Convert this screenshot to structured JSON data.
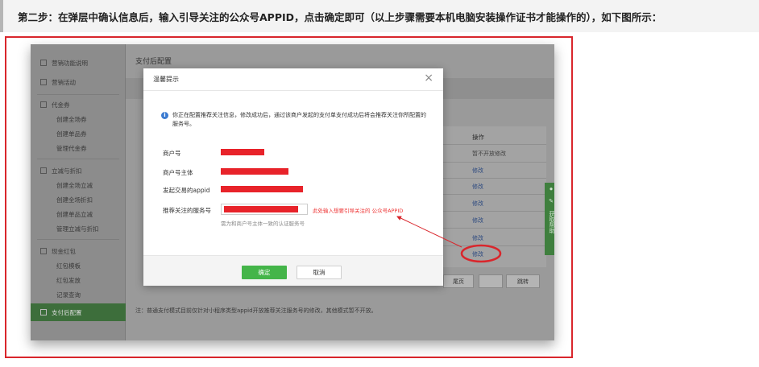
{
  "step_banner": "第二步：在弹层中确认信息后，输入引导关注的公众号APPID，点击确定即可（以上步骤需要本机电脑安装操作证书才能操作的），如下图所示：",
  "sidebar": {
    "groups": [
      {
        "label": "营销功能说明"
      },
      {
        "label": "营销活动"
      },
      {
        "label": "代金券",
        "items": [
          "创建全场券",
          "创建单品券",
          "管理代金券"
        ]
      },
      {
        "label": "立减与折扣",
        "items": [
          "创建全场立减",
          "创建全场折扣",
          "创建单品立减",
          "管理立减与折扣"
        ]
      },
      {
        "label": "现金红包",
        "items": [
          "红包模板",
          "红包发放",
          "记录查询"
        ]
      }
    ],
    "active_item": "支付后配置"
  },
  "main": {
    "title": "支付后配置",
    "operation_header": "操作",
    "operation_cells": [
      "暂不开放修改",
      "修改",
      "修改",
      "修改",
      "修改",
      "修改",
      "修改"
    ],
    "pager": {
      "last_page": "尾页",
      "goto": "跳转"
    },
    "footer_note": "注：普通支付模式目前仅针对小程序类型appid开放推荐关注服务号的修改，其他模式暂不开放。",
    "side_tab": {
      "label": "获取帮助"
    }
  },
  "dialog": {
    "title": "温馨提示",
    "close_glyph": "×",
    "info_text": "你正在配置推荐关注信息，修改成功后，通过该商户发起的支付单支付成功后将会推荐关注你所配置的服务号。",
    "fields": {
      "merchant_id": "商户号",
      "merchant_entity": "商户号主体",
      "appid": "发起交易的appid",
      "recommended_account": "推荐关注的服务号"
    },
    "input_hint_red": "此处输入想要引导关注的 公众号APPID",
    "input_hint_gray": "需为和商户号主体一致的认证服务号",
    "confirm_label": "确定",
    "cancel_label": "取消"
  },
  "colors": {
    "annotation_red": "#d9262c",
    "confirm_green": "#44b549",
    "sidebar_active": "#3d6e3b"
  }
}
